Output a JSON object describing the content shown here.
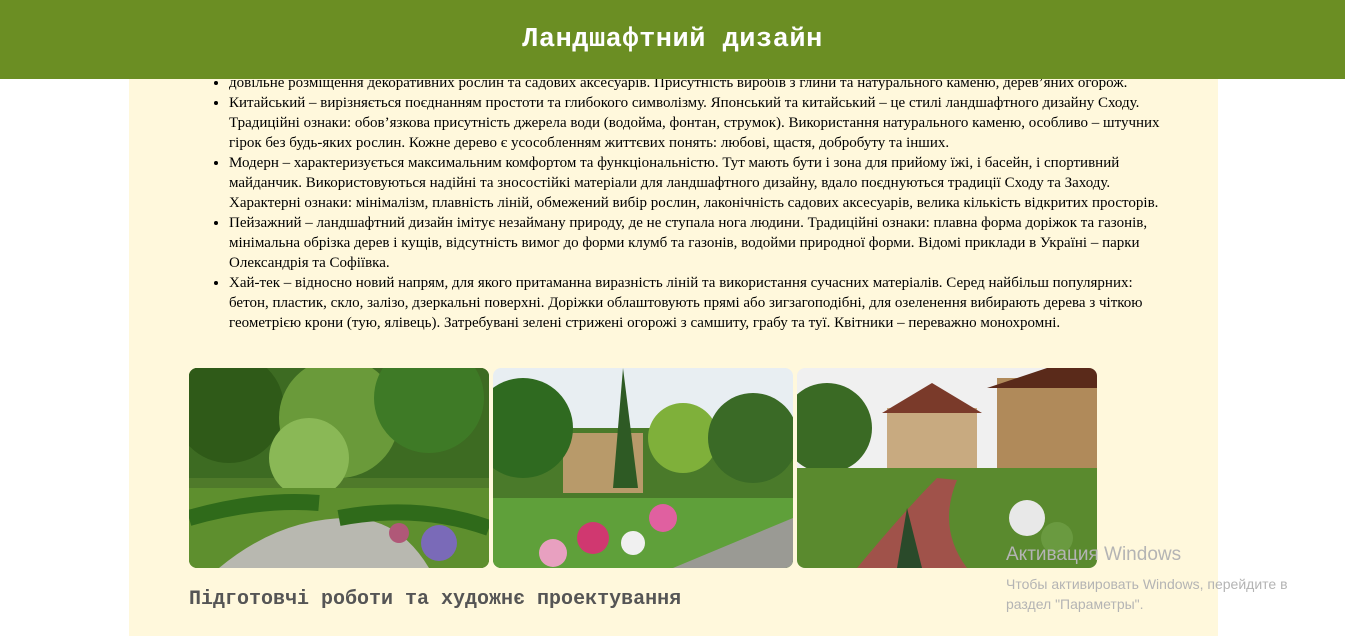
{
  "header": {
    "title": "Ландшафтний дизайн"
  },
  "styles_list": [
    "довільне розміщення декоративних рослин та садових аксесуарів. Присутність виробів з глини та натурального каменю, дерев’яних огорож.",
    "Китайський – вирізняється поєднанням простоти та глибокого символізму. Японський та китайський – це стилі ландшафтного дизайну Сходу. Традиційні ознаки: обов’язкова присутність джерела води (водойма, фонтан, струмок). Використання натурального каменю, особливо – штучних гірок без будь-яких рослин. Кожне дерево є усособленням життєвих понять: любові, щастя, добробуту та інших.",
    "Модерн – характеризується максимальним комфортом та функціональністю. Тут мають бути і зона для прийому їжі, і басейн, і спортивний майданчик. Використовуються надійні та зносостійкі матеріали для ландшафтного дизайну, вдало поєднуються традиції Сходу та Заходу. Характерні ознаки: мінімалізм, плавність ліній, обмежений вибір рослин, лаконічність садових аксесуарів, велика кількість відкритих просторів.",
    "Пейзажний – ландшафтний дизайн імітує незайману природу, де не ступала нога людини. Традиційні ознаки: плавна форма доріжок та газонів, мінімальна обрізка дерев і кущів, відсутність вимог до форми клумб та газонів, водойми природної форми. Відомі приклади в Україні – парки Олександрія та Софіївка.",
    "Хай-тек – відносно новий напрям, для якого притаманна виразність ліній та використання сучасних матеріалів. Серед найбільш популярних: бетон, пластик, скло, залізо, дзеркальні поверхні. Доріжки облаштовують прямі або зигзагоподібні, для озеленення вибирають дерева з чіткою геометрією крони (тую, ялівець). Затребувані зелені стрижені огорожі з самшиту, грабу та туї. Квітники – переважно монохромні."
  ],
  "gallery": {
    "photos": [
      "garden-photo-hedges",
      "garden-photo-lawn-flowers",
      "garden-photo-house-path"
    ]
  },
  "section": {
    "heading": "Підготовчі роботи та художнє проектування"
  },
  "watermark": {
    "title": "Активация Windows",
    "subtitle_line1": "Чтобы активировать Windows, перейдите в",
    "subtitle_line2": "раздел \"Параметры\"."
  },
  "colors": {
    "header_bg": "#6b8e23",
    "content_bg": "#fff8dc"
  }
}
